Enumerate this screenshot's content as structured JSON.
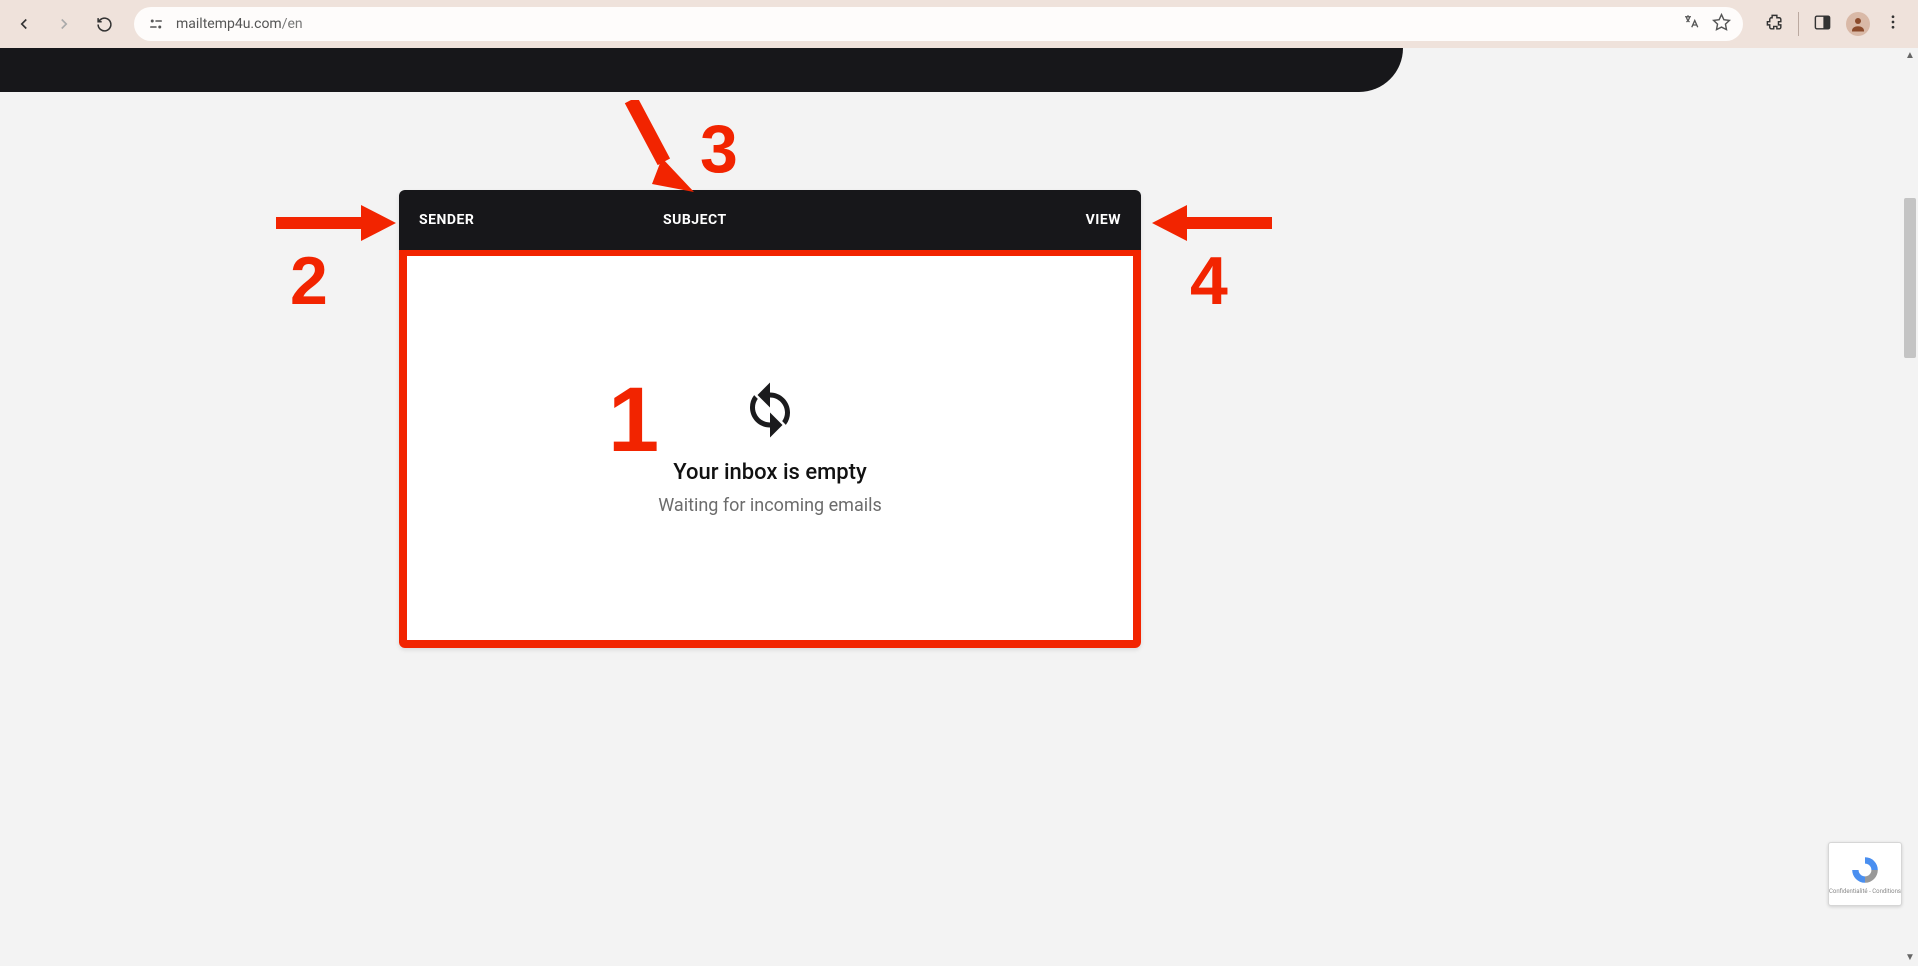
{
  "browser": {
    "url_host": "mailtemp4u.com",
    "url_path": "/en"
  },
  "inbox": {
    "columns": {
      "sender": "SENDER",
      "subject": "SUBJECT",
      "view": "VIEW"
    },
    "empty_title": "Your inbox is empty",
    "empty_subtitle": "Waiting for incoming emails"
  },
  "annotations": {
    "n1": "1",
    "n2": "2",
    "n3": "3",
    "n4": "4"
  },
  "recaptcha": {
    "line": "Confidentialité - Conditions"
  }
}
